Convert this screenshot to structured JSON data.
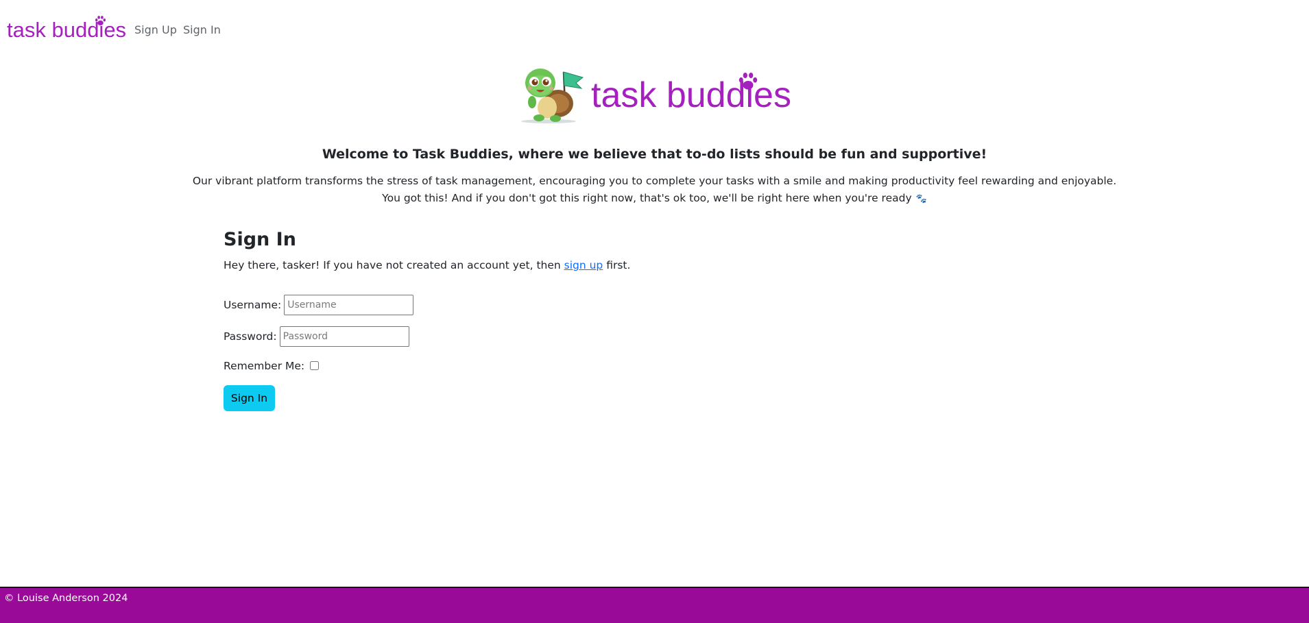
{
  "navbar": {
    "brand": "task buddies",
    "links": {
      "sign_up": "Sign Up",
      "sign_in": "Sign In"
    }
  },
  "hero": {
    "logo_icon": "turtle-with-flag-icon",
    "title": "task buddies",
    "welcome": "Welcome to Task Buddies, where we believe that to-do lists should be fun and supportive!",
    "intro_line1": "Our vibrant platform transforms the stress of task management, encouraging you to complete your tasks with a smile and making productivity feel rewarding and enjoyable.",
    "intro_line2": "You got this! And if you don't got this right now, that's ok too, we'll be right here when you're ready",
    "intro_paws": "🐾"
  },
  "signin": {
    "heading": "Sign In",
    "sub_before": "Hey there, tasker! If you have not created an account yet, then ",
    "sub_link": "sign up",
    "sub_after": " first.",
    "username_label": "Username:",
    "username_placeholder": "Username",
    "username_value": "",
    "password_label": "Password:",
    "password_placeholder": "Password",
    "password_value": "",
    "remember_label": "Remember Me:",
    "remember_checked": false,
    "button_label": "Sign In"
  },
  "footer": {
    "text": "© Louise Anderson 2024"
  },
  "colors": {
    "brand_purple": "#a61fbf",
    "footer_purple": "#990a99",
    "button_cyan": "#0dcaf0",
    "link_blue": "#0d6efd"
  }
}
